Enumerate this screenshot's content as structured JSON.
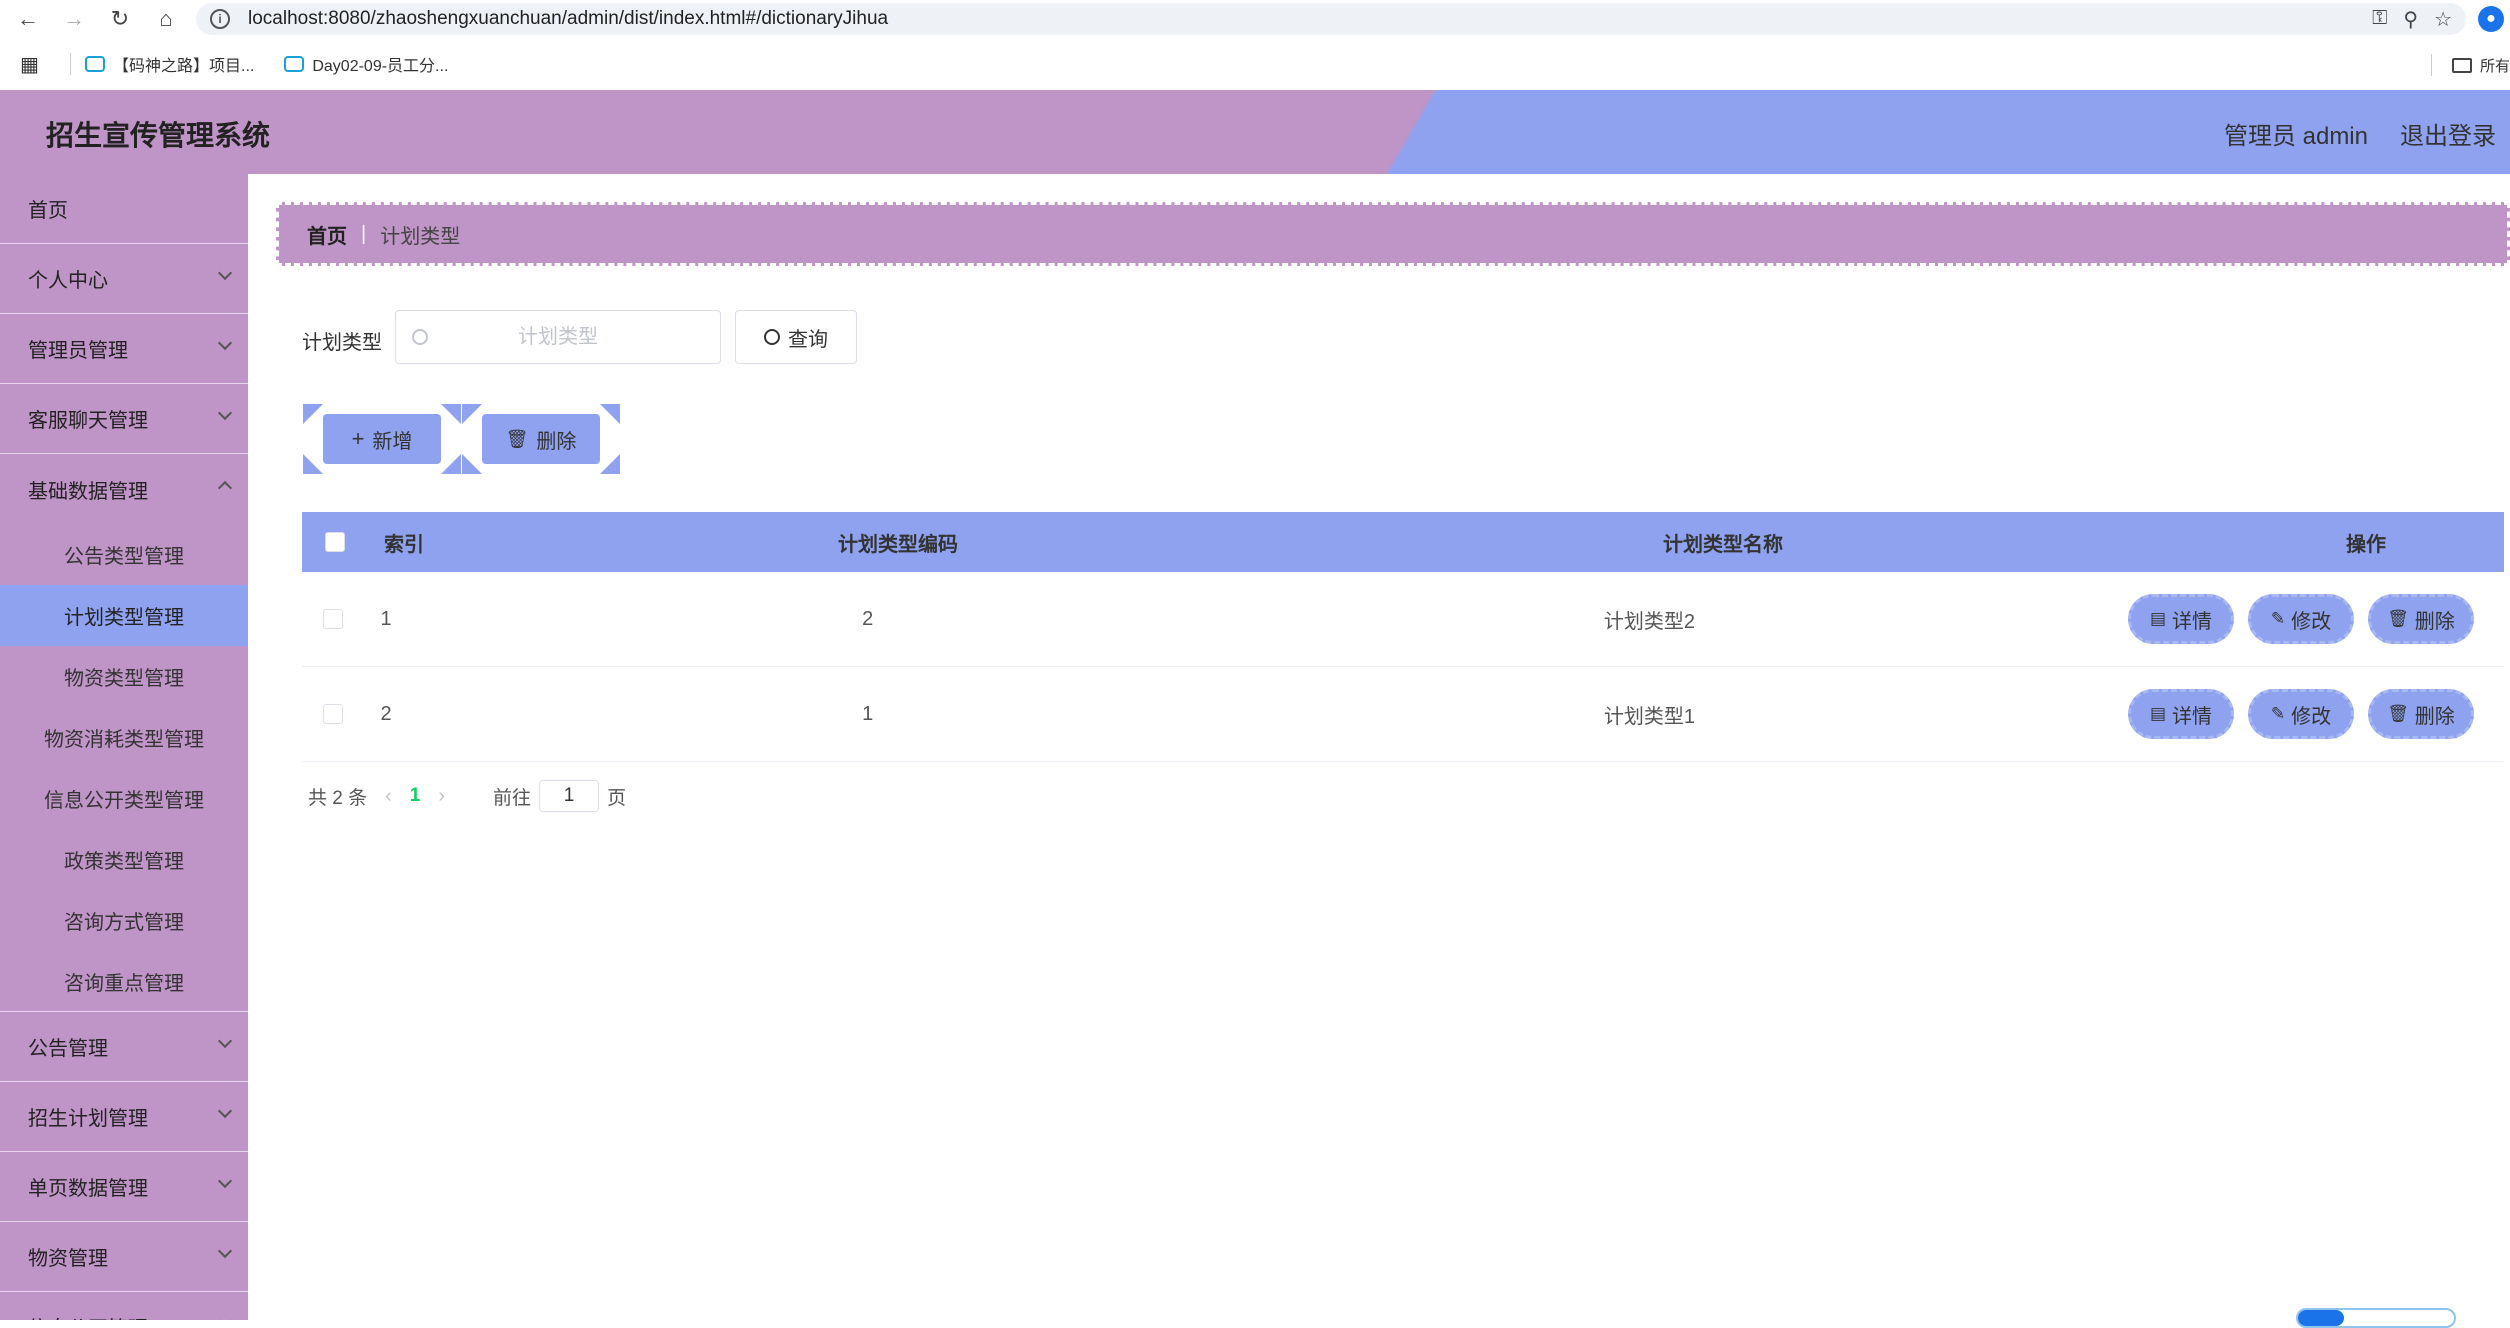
{
  "browser": {
    "url": "localhost:8080/zhaoshengxuanchuan/admin/dist/index.html#/dictionaryJihua",
    "bookmarks": [
      "【码神之路】项目...",
      "Day02-09-员工分..."
    ],
    "bookmarks_right": "所有"
  },
  "header": {
    "title": "招生宣传管理系统",
    "user": "管理员 admin",
    "logout": "退出登录"
  },
  "sidebar": {
    "items_top": [
      {
        "label": "首页",
        "chevron": false
      },
      {
        "label": "个人中心",
        "chevron": true
      },
      {
        "label": "管理员管理",
        "chevron": true
      },
      {
        "label": "客服聊天管理",
        "chevron": true
      },
      {
        "label": "基础数据管理",
        "chevron": true
      }
    ],
    "submenu": [
      {
        "label": "公告类型管理",
        "active": false
      },
      {
        "label": "计划类型管理",
        "active": true
      },
      {
        "label": "物资类型管理",
        "active": false
      },
      {
        "label": "物资消耗类型管理",
        "active": false
      },
      {
        "label": "信息公开类型管理",
        "active": false
      },
      {
        "label": "政策类型管理",
        "active": false
      },
      {
        "label": "咨询方式管理",
        "active": false
      },
      {
        "label": "咨询重点管理",
        "active": false
      }
    ],
    "items_bottom": [
      {
        "label": "公告管理"
      },
      {
        "label": "招生计划管理"
      },
      {
        "label": "单页数据管理"
      },
      {
        "label": "物资管理"
      },
      {
        "label": "信息公开管理"
      }
    ]
  },
  "breadcrumb": {
    "home": "首页",
    "separator": "|",
    "current": "计划类型"
  },
  "search": {
    "label": "计划类型",
    "placeholder": "计划类型",
    "value": "",
    "button": "查询"
  },
  "actions": {
    "add": "新增",
    "delete": "删除"
  },
  "table": {
    "headers": {
      "index": "索引",
      "code": "计划类型编码",
      "name": "计划类型名称",
      "ops": "操作"
    },
    "rows": [
      {
        "index": "1",
        "code": "2",
        "name": "计划类型2"
      },
      {
        "index": "2",
        "code": "1",
        "name": "计划类型1"
      }
    ],
    "row_ops": {
      "detail": "详情",
      "edit": "修改",
      "delete": "删除"
    }
  },
  "pagination": {
    "total": "共 2 条",
    "current": "1",
    "goto_prefix": "前往",
    "goto_value": "1",
    "goto_suffix": "页"
  },
  "colors": {
    "sidebar": "#bf94c6",
    "accent": "#8ea2ef",
    "page_active": "#13ce66"
  }
}
